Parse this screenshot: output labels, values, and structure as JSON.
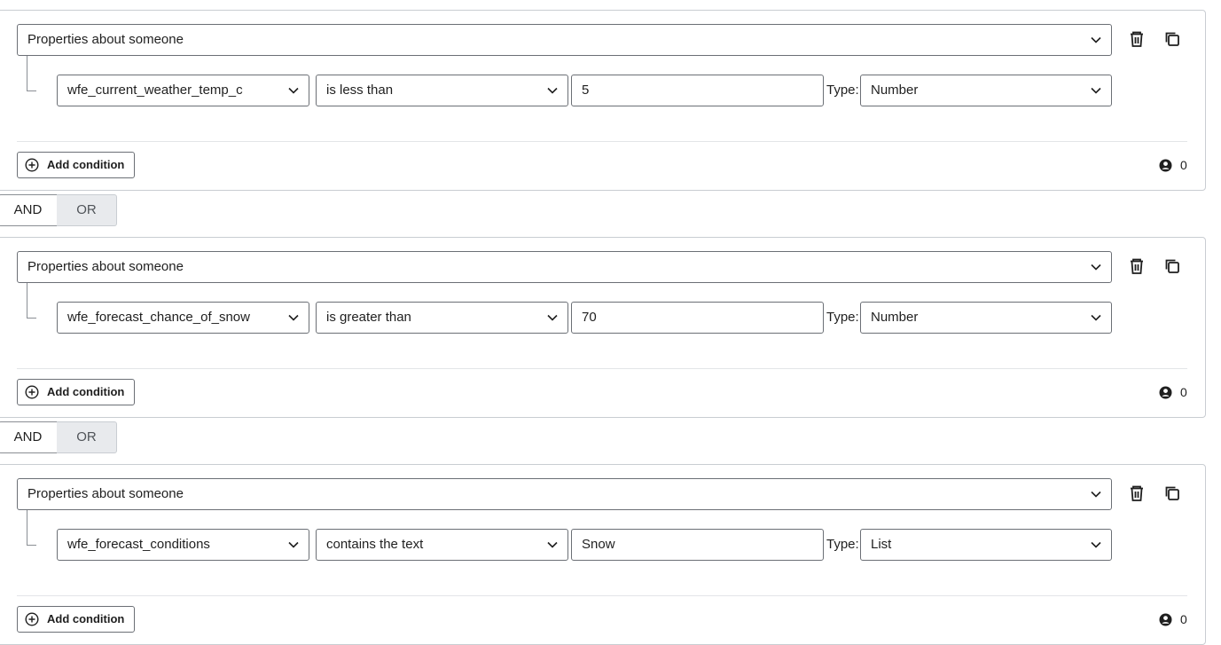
{
  "groups": [
    {
      "scope": "Properties about someone",
      "field": "wfe_current_weather_temp_c",
      "operator": "is less than",
      "value": "5",
      "type_label": "Type:",
      "type": "Number",
      "add_label": "Add condition",
      "count": "0"
    },
    {
      "scope": "Properties about someone",
      "field": "wfe_forecast_chance_of_snow",
      "operator": "is greater than",
      "value": "70",
      "type_label": "Type:",
      "type": "Number",
      "add_label": "Add condition",
      "count": "0"
    },
    {
      "scope": "Properties about someone",
      "field": "wfe_forecast_conditions",
      "operator": "contains the text",
      "value": "Snow",
      "type_label": "Type:",
      "type": "List",
      "add_label": "Add condition",
      "count": "0"
    }
  ],
  "joins": [
    {
      "and_label": "AND",
      "or_label": "OR",
      "selected": "AND"
    },
    {
      "and_label": "AND",
      "or_label": "OR",
      "selected": "AND"
    }
  ],
  "icons": {
    "delete": "trash-icon",
    "duplicate": "copy-icon",
    "dropdown": "chevron-down-icon",
    "add": "plus-circle-icon",
    "count": "person-icon"
  }
}
